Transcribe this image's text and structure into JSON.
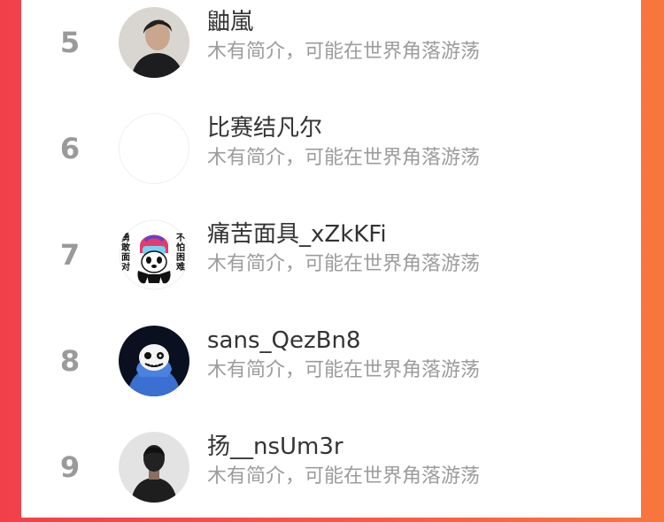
{
  "ranking": {
    "items": [
      {
        "rank": "5",
        "name": "鼬嵐",
        "bio": "木有简介，可能在世界角落游荡",
        "avatar": "person-photo-dark"
      },
      {
        "rank": "6",
        "name": "比赛结凡尔",
        "bio": "木有简介，可能在世界角落游荡",
        "avatar": "blank"
      },
      {
        "rank": "7",
        "name": "痛苦面具_xZkKFi",
        "bio": "木有简介，可能在世界角落游荡",
        "avatar": "cartoon-helmet-panda"
      },
      {
        "rank": "8",
        "name": "sans_QezBn8",
        "bio": "木有简介，可能在世界角落游荡",
        "avatar": "cartoon-skeleton-hoodie"
      },
      {
        "rank": "9",
        "name": "扬__nsUm3r",
        "bio": "木有简介，可能在世界角落游荡",
        "avatar": "person-back-view"
      }
    ]
  },
  "avatar_text": {
    "left": "勇敢面对",
    "right": "不怕困难"
  },
  "colors": {
    "background_left": "#f2404a",
    "background_right": "#f8773e",
    "rank": "#9a9a9a",
    "name": "#333333",
    "bio": "#9c9c9c"
  }
}
